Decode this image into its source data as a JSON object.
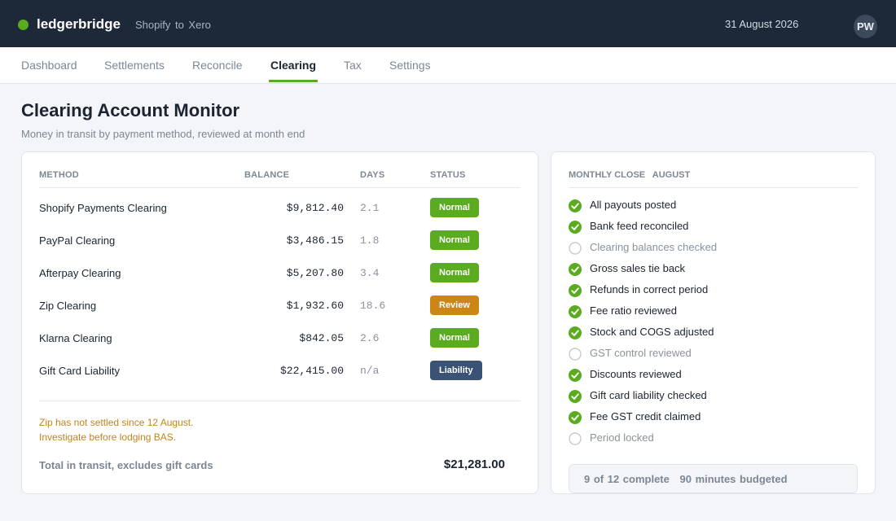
{
  "app": {
    "brand": "ledgerbridge",
    "subtitle": "Shopify  to  Xero",
    "date": "31 August 2026",
    "user_initials": "PW",
    "accent_color": "#5aab1e"
  },
  "tabs": [
    {
      "label": "Dashboard",
      "active": false
    },
    {
      "label": "Settlements",
      "active": false
    },
    {
      "label": "Reconcile",
      "active": false
    },
    {
      "label": "Clearing",
      "active": true
    },
    {
      "label": "Tax",
      "active": false
    },
    {
      "label": "Settings",
      "active": false
    }
  ],
  "page": {
    "title": "Clearing Account Monitor",
    "description": "Money in transit by payment method, reviewed at month end"
  },
  "table": {
    "headers": {
      "method": "METHOD",
      "balance": "BALANCE",
      "days": "DAYS",
      "status": "STATUS"
    },
    "rows": [
      {
        "method": "Shopify Payments Clearing",
        "balance": "$9,812.40",
        "days": "2.1",
        "status": "Normal",
        "status_kind": "normal"
      },
      {
        "method": "PayPal Clearing",
        "balance": "$3,486.15",
        "days": "1.8",
        "status": "Normal",
        "status_kind": "normal"
      },
      {
        "method": "Afterpay Clearing",
        "balance": "$5,207.80",
        "days": "3.4",
        "status": "Normal",
        "status_kind": "normal"
      },
      {
        "method": "Zip Clearing",
        "balance": "$1,932.60",
        "days": "18.6",
        "status": "Review",
        "status_kind": "review"
      },
      {
        "method": "Klarna Clearing",
        "balance": "$842.05",
        "days": "2.6",
        "status": "Normal",
        "status_kind": "normal"
      },
      {
        "method": "Gift Card Liability",
        "balance": "$22,415.00",
        "days": "n/a",
        "status": "Liability",
        "status_kind": "liability"
      }
    ],
    "warning_line1": "Zip has not settled since 12 August.",
    "warning_line2": "Investigate before lodging BAS.",
    "total_label": "Total in transit, excludes gift cards",
    "total_value": "$21,281.00"
  },
  "status_colors": {
    "normal": "#5aab1e",
    "review": "#cc8615",
    "liability": "#3a5274"
  },
  "monthly_close": {
    "header_label": "MONTHLY CLOSE",
    "header_month": "AUGUST",
    "items": [
      {
        "label": "All payouts posted",
        "done": true
      },
      {
        "label": "Bank feed reconciled",
        "done": true
      },
      {
        "label": "Clearing balances checked",
        "done": false
      },
      {
        "label": "Gross sales tie back",
        "done": true
      },
      {
        "label": "Refunds in correct period",
        "done": true
      },
      {
        "label": "Fee ratio reviewed",
        "done": true
      },
      {
        "label": "Stock and COGS adjusted",
        "done": true
      },
      {
        "label": "GST control reviewed",
        "done": false
      },
      {
        "label": "Discounts reviewed",
        "done": true
      },
      {
        "label": "Gift card liability checked",
        "done": true
      },
      {
        "label": "Fee GST credit claimed",
        "done": true
      },
      {
        "label": "Period locked",
        "done": false
      }
    ],
    "progress_text": "9 of 12 complete",
    "budget_text": "90 minutes budgeted"
  }
}
